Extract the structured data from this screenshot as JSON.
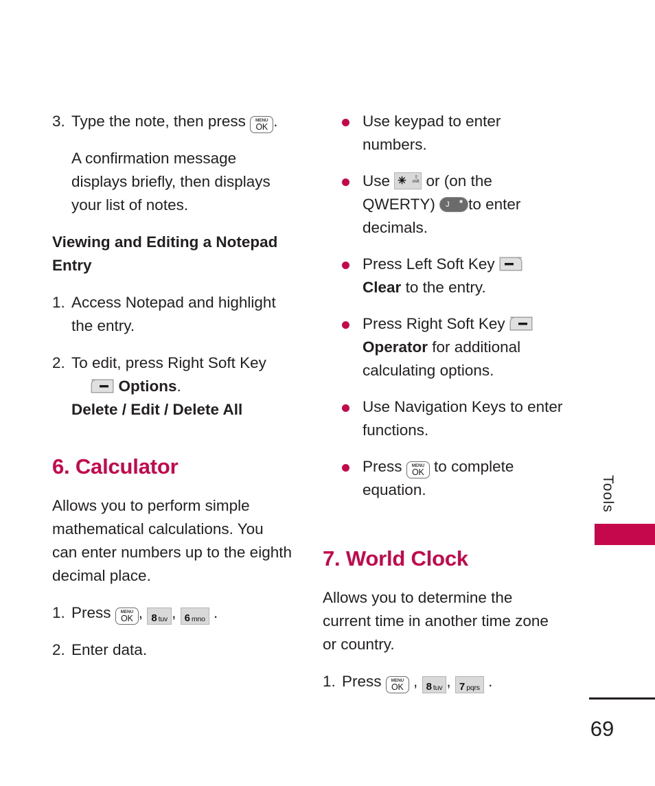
{
  "page": {
    "number": "69",
    "tab_label": "Tools",
    "accent_color": "#c5084b",
    "text_color": "#231f20"
  },
  "keys": {
    "menu_ok": {
      "top": "MENU",
      "bottom": "OK",
      "name": "menu-ok-key"
    },
    "eight_tuv": {
      "digit": "8",
      "letters": "tuv"
    },
    "six_mno": {
      "digit": "6",
      "letters": "mno"
    },
    "seven_pqrs": {
      "digit": "7",
      "letters": "pqrs"
    },
    "star_shift": {
      "glyph": "✳",
      "label": "shift"
    },
    "qwerty_j": {
      "letter": "J",
      "symbol": "*"
    }
  },
  "left_column": {
    "step3": {
      "number": "3.",
      "text_before": "Type the note, then press",
      "text_after": "."
    },
    "step3_detail": "A confirmation message displays briefly, then displays your list of notes.",
    "subheading": "Viewing and Editing a Notepad Entry",
    "step1": {
      "number": "1.",
      "text": "Access Notepad and highlight the entry."
    },
    "step2": {
      "number": "2.",
      "text": "To edit, press Right Soft Key",
      "bold_label": "Options",
      "period": ".",
      "options_list": "Delete / Edit / Delete All"
    },
    "calculator": {
      "heading": "6. Calculator",
      "body": "Allows you to perform simple mathematical calculations. You can enter numbers up to the eighth decimal place.",
      "step1_number": "1.",
      "step1_text": "Press",
      "comma": ",",
      "period": ".",
      "step2_number": "2.",
      "step2_text": "Enter data."
    }
  },
  "right_column": {
    "bullets": [
      {
        "id": "bullet-keypad",
        "text": "Use keypad to enter numbers."
      },
      {
        "id": "bullet-decimals",
        "pre": "Use",
        "mid": "or (on the QWERTY)",
        "post": "to enter decimals."
      },
      {
        "id": "bullet-left-soft-key",
        "pre": "Press Left Soft Key",
        "bold": "Clear",
        "post": "to the entry."
      },
      {
        "id": "bullet-right-soft-key",
        "pre": "Press Right Soft Key",
        "bold": "Operator",
        "post": "for additional calculating options."
      },
      {
        "id": "bullet-navigation-keys",
        "text": "Use Navigation Keys to enter functions."
      },
      {
        "id": "bullet-complete-equation",
        "pre": "Press",
        "post": "to complete equation."
      }
    ],
    "world_clock": {
      "heading": "7. World Clock",
      "body": "Allows you to determine the current time in another time zone or country.",
      "step1_number": "1.",
      "step1_text": "Press",
      "comma": ",",
      "period": "."
    }
  }
}
